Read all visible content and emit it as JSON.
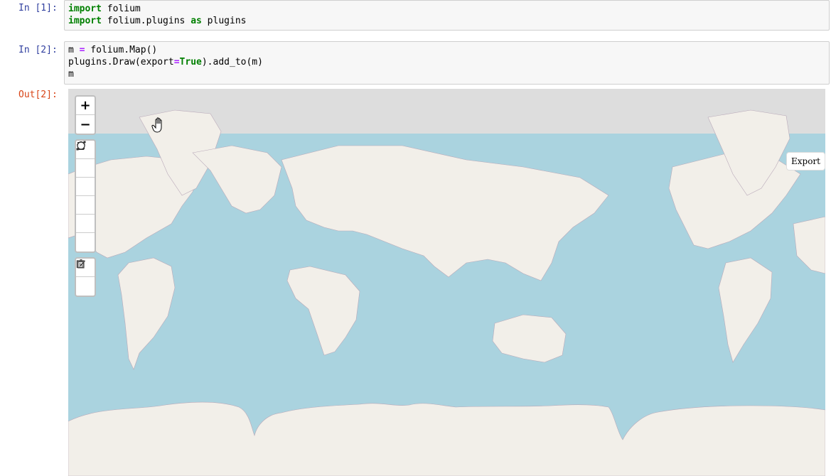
{
  "cells": [
    {
      "prompt": "In [1]:",
      "lines": [
        [
          [
            "kw",
            "import"
          ],
          [
            "t",
            " folium"
          ]
        ],
        [
          [
            "kw",
            "import"
          ],
          [
            "t",
            " folium.plugins "
          ],
          [
            "kw",
            "as"
          ],
          [
            "t",
            " plugins"
          ]
        ]
      ]
    },
    {
      "prompt": "In [2]:",
      "lines": [
        [
          [
            "t",
            "m "
          ],
          [
            "op",
            "="
          ],
          [
            "t",
            " folium.Map()"
          ]
        ],
        [
          [
            "t",
            "plugins.Draw(export"
          ],
          [
            "op",
            "="
          ],
          [
            "kw",
            "True"
          ],
          [
            "t",
            ").add_to(m)"
          ]
        ],
        [
          [
            "t",
            "m"
          ]
        ]
      ]
    }
  ],
  "output": {
    "prompt": "Out[2]:",
    "map": {
      "colors": {
        "ocean": "#aad3df",
        "land": "#f2efe9",
        "border": "#b9a9b9",
        "tile_empty": "#dddddd"
      },
      "zoom_in_label": "+",
      "zoom_out_label": "−",
      "draw_tools": [
        "polyline-icon",
        "polygon-icon",
        "rectangle-icon",
        "circle-icon",
        "marker-icon",
        "circlemarker-icon"
      ],
      "edit_tools": [
        "edit-icon",
        "trash-icon"
      ],
      "export_label": "Export"
    }
  }
}
